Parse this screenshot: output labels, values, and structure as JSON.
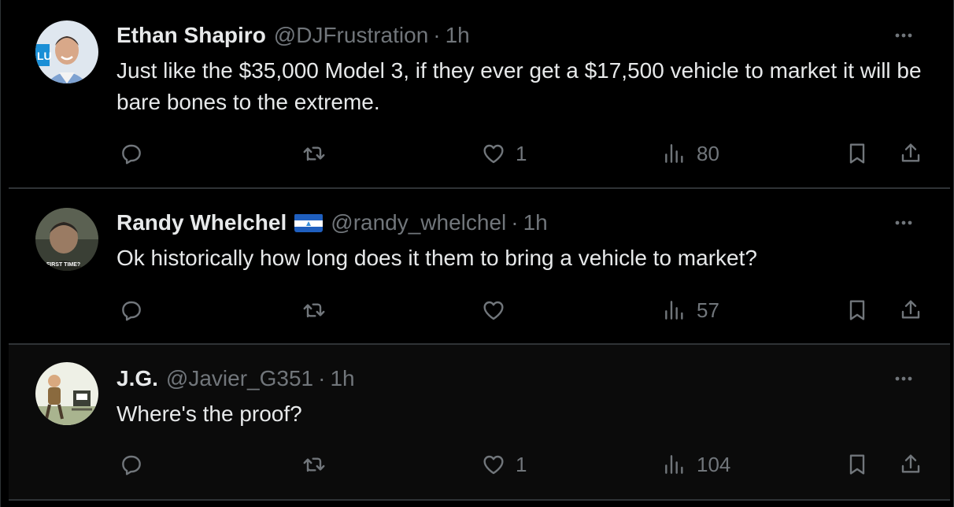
{
  "colors": {
    "background": "#000000",
    "text_primary": "#e7e9ea",
    "text_secondary": "#71767b",
    "divider": "#2f3336"
  },
  "tweets": [
    {
      "name": "Ethan Shapiro",
      "handle": "@DJFrustration",
      "separator": "·",
      "time": "1h",
      "text": "Just like the $35,000 Model 3, if they ever get a $17,500 vehicle to market it will be bare bones to the extreme.",
      "replies": "",
      "retweets": "",
      "likes": "1",
      "views": "80"
    },
    {
      "name": "Randy Whelchel",
      "handle": "@randy_whelchel",
      "separator": "·",
      "time": "1h",
      "text": "Ok historically how long does it them to bring a vehicle to market?",
      "flag_icon": "nicaragua-flag-icon",
      "avatar_caption": "FIRST TIME?",
      "replies": "",
      "retweets": "",
      "likes": "",
      "views": "57"
    },
    {
      "name": "J.G.",
      "handle": "@Javier_G351",
      "separator": "·",
      "time": "1h",
      "text": "Where's the proof?",
      "replies": "",
      "retweets": "",
      "likes": "1",
      "views": "104"
    }
  ],
  "icons": {
    "reply": "reply-icon",
    "retweet": "retweet-icon",
    "like": "heart-icon",
    "views": "views-icon",
    "bookmark": "bookmark-icon",
    "share": "share-icon",
    "more": "more-icon"
  }
}
